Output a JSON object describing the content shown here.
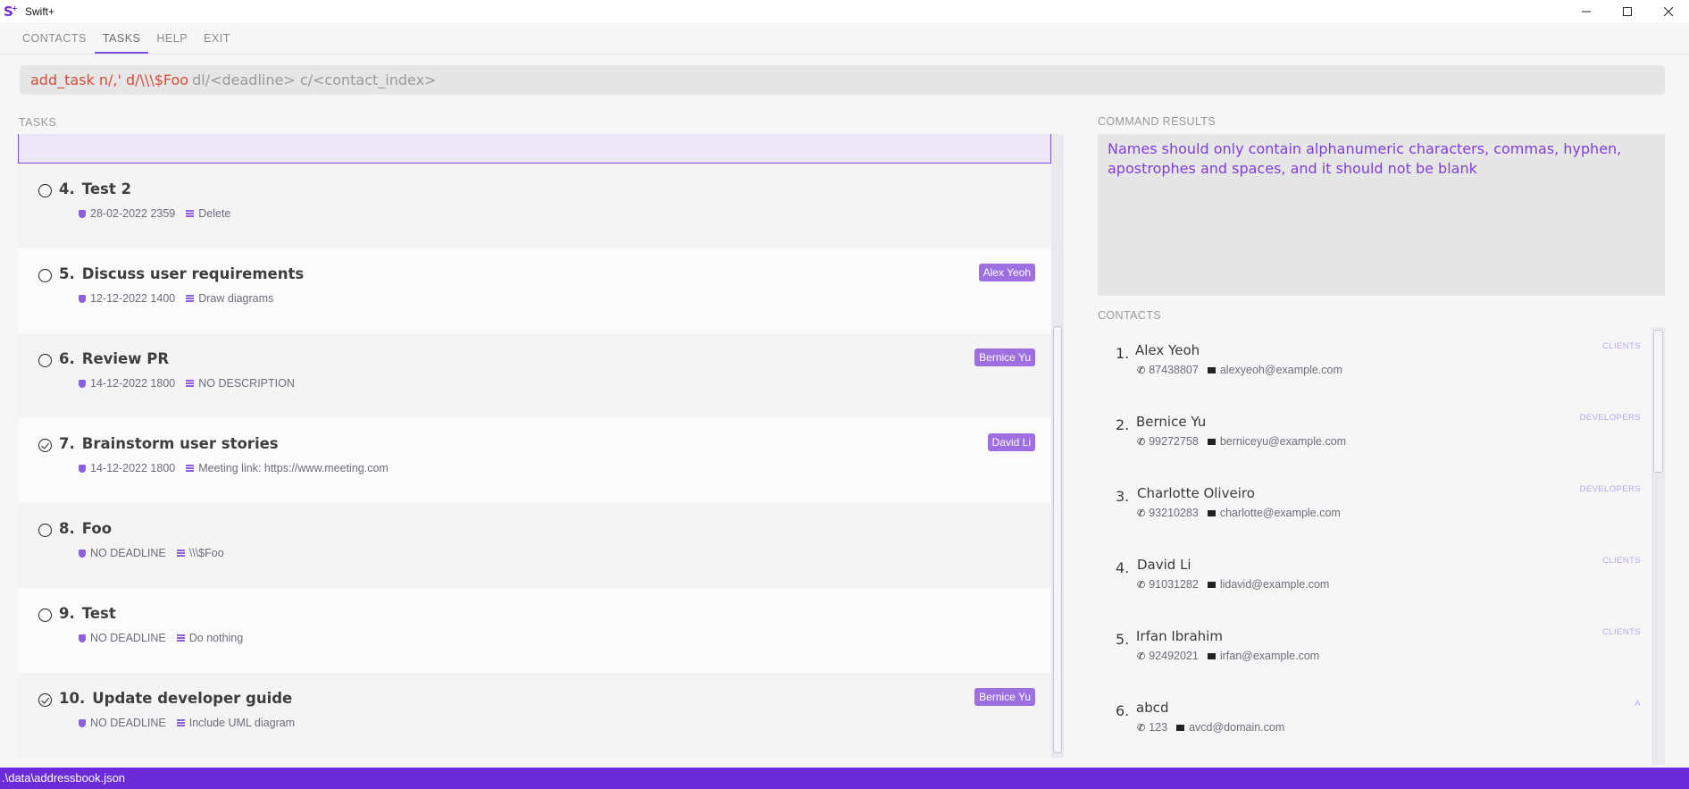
{
  "app": {
    "title": "Swift+",
    "logo": "S"
  },
  "window_controls": [
    {
      "name": "minimize-icon",
      "glyph": "—"
    },
    {
      "name": "maximize-icon",
      "glyph": "☐"
    },
    {
      "name": "close-icon",
      "glyph": "✕"
    }
  ],
  "menu": {
    "items": [
      "CONTACTS",
      "TASKS",
      "HELP",
      "EXIT"
    ],
    "active": "TASKS"
  },
  "command": {
    "value": "add_task n/,' d/\\\\\\$Foo",
    "hint": "dl/<deadline> c/<contact_index>"
  },
  "tasks_label": "TASKS",
  "tasks": [
    {
      "index": "4.",
      "name": "Test 2",
      "done": true,
      "deadline": "28-02-2022 2359",
      "description": "Delete",
      "tag": ""
    },
    {
      "index": "5.",
      "name": "Discuss user requirements",
      "done": false,
      "deadline": "12-12-2022 1400",
      "description": "Draw diagrams",
      "tag": "Alex Yeoh"
    },
    {
      "index": "6.",
      "name": "Review PR",
      "done": false,
      "deadline": "14-12-2022 1800",
      "description": "NO DESCRIPTION",
      "tag": "Bernice Yu"
    },
    {
      "index": "7.",
      "name": "Brainstorm user stories",
      "done": true,
      "deadline": "14-12-2022 1800",
      "description": "Meeting link: https://www.meeting.com",
      "tag": "David Li"
    },
    {
      "index": "8.",
      "name": "Foo",
      "done": false,
      "deadline": "NO DEADLINE",
      "description": "\\\\\\$Foo",
      "tag": ""
    },
    {
      "index": "9.",
      "name": "Test",
      "done": false,
      "deadline": "NO DEADLINE",
      "description": "Do nothing",
      "tag": ""
    },
    {
      "index": "10.",
      "name": "Update developer guide",
      "done": true,
      "deadline": "NO DEADLINE",
      "description": "Include UML diagram",
      "tag": "Bernice Yu"
    }
  ],
  "results_label": "COMMAND RESULTS",
  "results_text": "Names should only contain alphanumeric characters, commas, hyphen, apostrophes and spaces, and it should not be blank",
  "contacts_label": "CONTACTS",
  "contacts": [
    {
      "index": "1.",
      "name": "Alex Yeoh",
      "phone": "87438807",
      "email": "alexyeoh@example.com",
      "tag": "CLIENTS"
    },
    {
      "index": "2.",
      "name": "Bernice Yu",
      "phone": "99272758",
      "email": "berniceyu@example.com",
      "tag": "DEVELOPERS"
    },
    {
      "index": "3.",
      "name": "Charlotte Oliveiro",
      "phone": "93210283",
      "email": "charlotte@example.com",
      "tag": "DEVELOPERS"
    },
    {
      "index": "4.",
      "name": "David Li",
      "phone": "91031282",
      "email": "lidavid@example.com",
      "tag": "CLIENTS"
    },
    {
      "index": "5.",
      "name": "Irfan Ibrahim",
      "phone": "92492021",
      "email": "irfan@example.com",
      "tag": "CLIENTS"
    },
    {
      "index": "6.",
      "name": "abcd",
      "phone": "123",
      "email": "avcd@domain.com",
      "tag": "A"
    }
  ],
  "status_bar": {
    "path": ".\\data\\addressbook.json"
  },
  "colors": {
    "accent": "#6c2bd9",
    "tag_bg": "#9d6fe0",
    "error_text": "#7f3ed8",
    "command_text": "#d04f3a"
  }
}
